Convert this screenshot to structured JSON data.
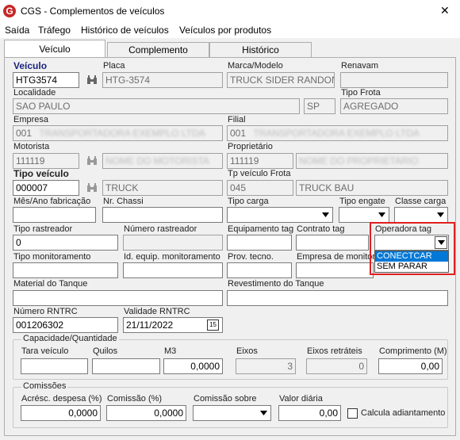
{
  "window": {
    "title": "CGS - Complementos de veículos",
    "close_symbol": "✕"
  },
  "menu": [
    "Saída",
    "Tráfego",
    "Histórico de veículos",
    "Veículos por produtos"
  ],
  "tabs": [
    {
      "label": "Veículo",
      "active": true
    },
    {
      "label": "Complemento",
      "active": false
    },
    {
      "label": "Histórico",
      "active": false
    }
  ],
  "labels": {
    "veiculo": "Veículo",
    "placa": "Placa",
    "marca_modelo": "Marca/Modelo",
    "renavam": "Renavam",
    "localidade": "Localidade",
    "tipo_frota": "Tipo Frota",
    "empresa": "Empresa",
    "filial": "Filial",
    "motorista": "Motorista",
    "proprietario": "Proprietário",
    "tipo_veiculo": "Tipo veículo",
    "tp_veiculo_frota": "Tp veículo Frota",
    "mes_ano_fabricacao": "Mês/Ano fabricação",
    "nr_chassi": "Nr. Chassi",
    "tipo_carga": "Tipo carga",
    "tipo_engate": "Tipo engate",
    "classe_carga": "Classe carga",
    "tipo_rastreador": "Tipo rastreador",
    "numero_rastreador": "Número rastreador",
    "equipamento_tag": "Equipamento tag",
    "contrato_tag": "Contrato tag",
    "operadora_tag": "Operadora tag",
    "tipo_monitoramento": "Tipo monitoramento",
    "id_equip_monitoramento": "Id. equip. monitoramento",
    "prov_tecno": "Prov. tecno.",
    "empresa_monitora": "Empresa de monitora",
    "material_tanque": "Material do Tanque",
    "revestimento_tanque": "Revestimento do Tanque",
    "numero_rntrc": "Número RNTRC",
    "validade_rntrc": "Validade RNTRC"
  },
  "values": {
    "veiculo": "HTG3574",
    "placa": "HTG-3574",
    "marca_modelo": "TRUCK SIDER RANDON",
    "localidade": "SAO PAULO",
    "uf": "SP",
    "tipo_frota": "AGREGADO",
    "empresa_code": "001",
    "empresa_name": "TRANSPORTADORA EXEMPLO LTDA",
    "filial_code": "001",
    "filial_name": "TRANSPORTADORA EXEMPLO LTDA",
    "motorista_code": "111119",
    "motorista_name": "NOME DO MOTORISTA",
    "proprietario_code": "111119",
    "proprietario_name": "NOME DO PROPRIETARIO",
    "tipo_veiculo_code": "000007",
    "tipo_veiculo_name": "TRUCK",
    "tp_frota_code": "045",
    "tp_frota_name": "TRUCK BAU",
    "tipo_rastreador": "0",
    "numero_rntrc": "001206302",
    "validade_rntrc": "21/11/2022",
    "calendar_icon": "15"
  },
  "operadora_options": [
    "CONECTCAR",
    "SEM PARAR"
  ],
  "capacidade": {
    "title": "Capacidade/Quantidade",
    "labels": [
      "Tara veículo",
      "Quilos",
      "M3",
      "Eixos",
      "Eixos retráteis",
      "Comprimento (M)"
    ],
    "values": [
      "",
      "",
      "0,0000",
      "3",
      "0",
      "0,00"
    ]
  },
  "comissoes": {
    "title": "Comissões",
    "labels": [
      "Acrésc. despesa (%)",
      "Comissão (%)",
      "Comissão sobre",
      "Valor diária"
    ],
    "values": [
      "0,0000",
      "0,0000",
      "",
      "0,00"
    ],
    "checkbox_label": "Calcula adiantamento"
  },
  "colors": {
    "highlight_red": "#e02020",
    "selection_blue": "#0078d7",
    "app_icon_red": "#c62828"
  }
}
